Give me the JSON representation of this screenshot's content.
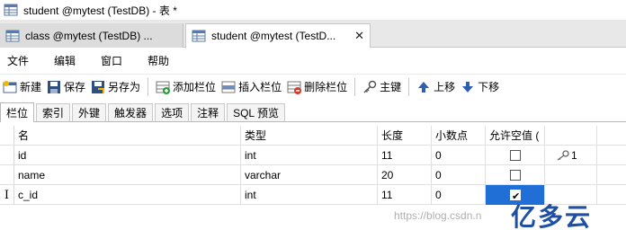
{
  "window": {
    "title": "student @mytest (TestDB) - 表 *"
  },
  "doc_tabs": [
    {
      "label": "class @mytest (TestDB) ...",
      "active": false
    },
    {
      "label": "student @mytest (TestD...",
      "active": true,
      "close": "✕"
    }
  ],
  "menu": [
    "文件",
    "编辑",
    "窗口",
    "帮助"
  ],
  "toolbar": {
    "new": "新建",
    "save": "保存",
    "save_as": "另存为",
    "add_field": "添加栏位",
    "insert_field": "插入栏位",
    "delete_field": "删除栏位",
    "primary_key": "主键",
    "move_up": "上移",
    "move_down": "下移"
  },
  "prop_tabs": [
    "栏位",
    "索引",
    "外键",
    "触发器",
    "选项",
    "注释",
    "SQL 预览"
  ],
  "grid": {
    "headers": {
      "name": "名",
      "type": "类型",
      "length": "长度",
      "decimal": "小数点",
      "allow_null": "允许空值 ("
    },
    "rows": [
      {
        "name": "id",
        "type": "int",
        "length": "11",
        "decimal": "0",
        "allow_null": false,
        "key": "1"
      },
      {
        "name": "name",
        "type": "varchar",
        "length": "20",
        "decimal": "0",
        "allow_null": false,
        "key": ""
      },
      {
        "name": "c_id",
        "type": "int",
        "length": "11",
        "decimal": "0",
        "allow_null": true,
        "key": ""
      }
    ],
    "cursor": "I"
  },
  "watermark": {
    "url": "https://blog.csdn.n",
    "logo": "亿多云"
  },
  "colors": {
    "selection": "#1f6fd6",
    "accent_blue": "#1f4fa3"
  }
}
